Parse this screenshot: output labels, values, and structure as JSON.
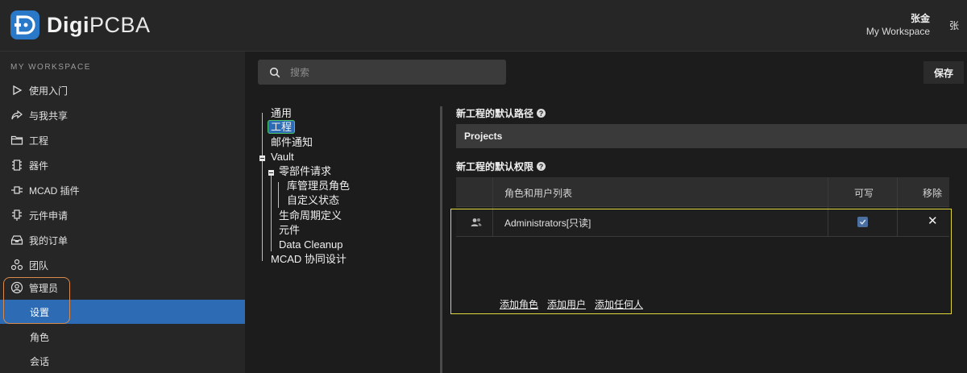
{
  "brand": {
    "name_bold": "Digi",
    "name_light": "PCBA"
  },
  "user": {
    "name": "张金",
    "workspace": "My Workspace",
    "avatar_text": "张"
  },
  "sidebar": {
    "section_title": "MY WORKSPACE",
    "items": [
      {
        "label": "使用入门",
        "icon": "play-icon"
      },
      {
        "label": "与我共享",
        "icon": "share-icon"
      },
      {
        "label": "工程",
        "icon": "folder-icon"
      },
      {
        "label": "器件",
        "icon": "chip-icon"
      },
      {
        "label": "MCAD 插件",
        "icon": "mcad-plugin-icon"
      },
      {
        "label": "元件申请",
        "icon": "component-request-icon"
      },
      {
        "label": "我的订单",
        "icon": "inbox-icon"
      },
      {
        "label": "团队",
        "icon": "team-icon"
      },
      {
        "label": "管理员",
        "icon": "user-circle-icon"
      }
    ],
    "sub_items": [
      {
        "label": "设置",
        "active": true
      },
      {
        "label": "角色",
        "active": false
      },
      {
        "label": "会话",
        "active": false
      }
    ]
  },
  "search": {
    "placeholder": "搜索"
  },
  "toolbar": {
    "save_label": "保存"
  },
  "tree": {
    "general": "通用",
    "project": "工程",
    "mail": "邮件通知",
    "vault": "Vault",
    "part_request": "零部件请求",
    "librarian_role": "库管理员角色",
    "custom_status": "自定义状态",
    "lifecycle": "生命周期定义",
    "component": "元件",
    "data_cleanup": "Data Cleanup",
    "mcad": "MCAD 协同设计"
  },
  "settings": {
    "default_path_label": "新工程的默认路径",
    "default_path_value": "Projects",
    "default_perm_label": "新工程的默认权限",
    "table": {
      "col_roles": "角色和用户列表",
      "col_writable": "可写",
      "col_remove": "移除",
      "rows": [
        {
          "name": "Administrators[只读]",
          "writable": true,
          "remove": "✕"
        }
      ]
    },
    "add_role": "添加角色",
    "add_user": "添加用户",
    "add_anyone": "添加任何人"
  },
  "colors": {
    "accent": "#2d6cb5",
    "highlight_yellow": "#e0d83a",
    "highlight_orange": "#d98b4e",
    "highlight_green": "#4cc46a"
  }
}
